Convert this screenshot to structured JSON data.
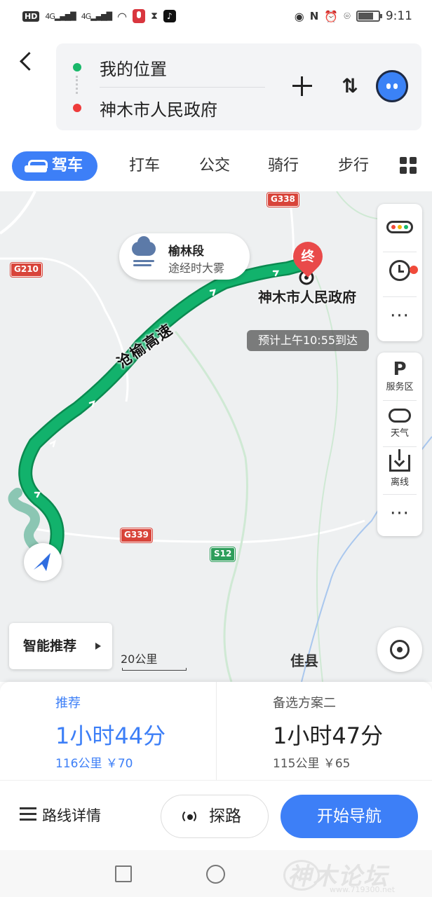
{
  "status_bar": {
    "network_chip": "HD",
    "signal_1": "4G",
    "signal_2": "4G",
    "time": "9:11"
  },
  "route": {
    "start": "我的位置",
    "end": "神木市人民政府",
    "start_dot_color": "#19b86a",
    "end_dot_color": "#ee3b3b"
  },
  "modes": [
    {
      "label": "驾车",
      "active": true
    },
    {
      "label": "打车"
    },
    {
      "label": "公交"
    },
    {
      "label": "骑行"
    },
    {
      "label": "步行"
    }
  ],
  "map": {
    "road_badges": [
      "G338",
      "G210",
      "G339",
      "S12"
    ],
    "weather": {
      "title": "榆林段",
      "subtitle": "途经时大雾"
    },
    "destination_marker": "终",
    "destination_name": "神木市人民政府",
    "eta": "预计上午10:55到达",
    "highway_name": "沧榆高速",
    "scale": "20公里",
    "city_label": "佳县",
    "smart_recommend": "智能推荐",
    "side_tools": [
      {
        "label": "服务区",
        "icon": "parking-icon"
      },
      {
        "label": "天气",
        "icon": "cloud-icon"
      },
      {
        "label": "离线",
        "icon": "download-icon"
      }
    ],
    "route_color": "#12b26c",
    "accent": "#3d7ff7"
  },
  "route_options": [
    {
      "label": "推荐",
      "time": "1小时44分",
      "distance": "116公里",
      "cost": "￥70"
    },
    {
      "label": "备选方案二",
      "time": "1小时47分",
      "distance": "115公里",
      "cost": "￥65"
    }
  ],
  "actions": {
    "details": "路线详情",
    "explore": "探路",
    "start_nav": "开始导航"
  },
  "watermark": {
    "text": "神木论坛",
    "url": "www.719300.net"
  }
}
